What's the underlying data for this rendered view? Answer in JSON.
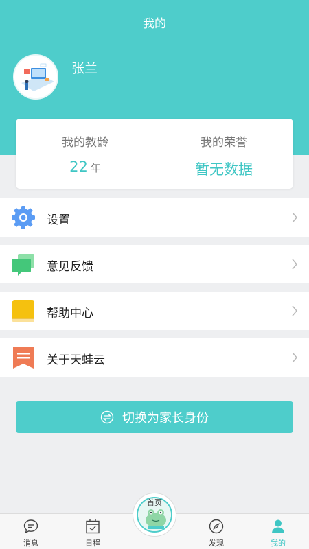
{
  "header": {
    "title": "我的"
  },
  "profile": {
    "name": "张兰"
  },
  "stats": {
    "teaching_age_label": "我的教龄",
    "teaching_age_value": "22",
    "teaching_age_unit": "年",
    "honor_label": "我的荣誉",
    "honor_value": "暂无数据"
  },
  "menu": [
    {
      "label": "设置",
      "icon": "gear-icon",
      "color": "#5b9cf4"
    },
    {
      "label": "意见反馈",
      "icon": "chat-icon",
      "color": "#44c77a"
    },
    {
      "label": "帮助中心",
      "icon": "book-icon",
      "color": "#f5c10f"
    },
    {
      "label": "关于天蛙云",
      "icon": "bookmark-icon",
      "color": "#ef7b55"
    }
  ],
  "switch_button": {
    "label": "切换为家长身份"
  },
  "tabbar": {
    "tabs": [
      {
        "label": "消息",
        "icon": "message-icon"
      },
      {
        "label": "日程",
        "icon": "calendar-icon"
      },
      {
        "label": "首页",
        "icon": "frog-logo-icon"
      },
      {
        "label": "发现",
        "icon": "compass-icon"
      },
      {
        "label": "我的",
        "icon": "user-icon"
      }
    ],
    "active": "我的"
  },
  "colors": {
    "accent": "#4ecdcb",
    "background": "#eeeff1"
  }
}
